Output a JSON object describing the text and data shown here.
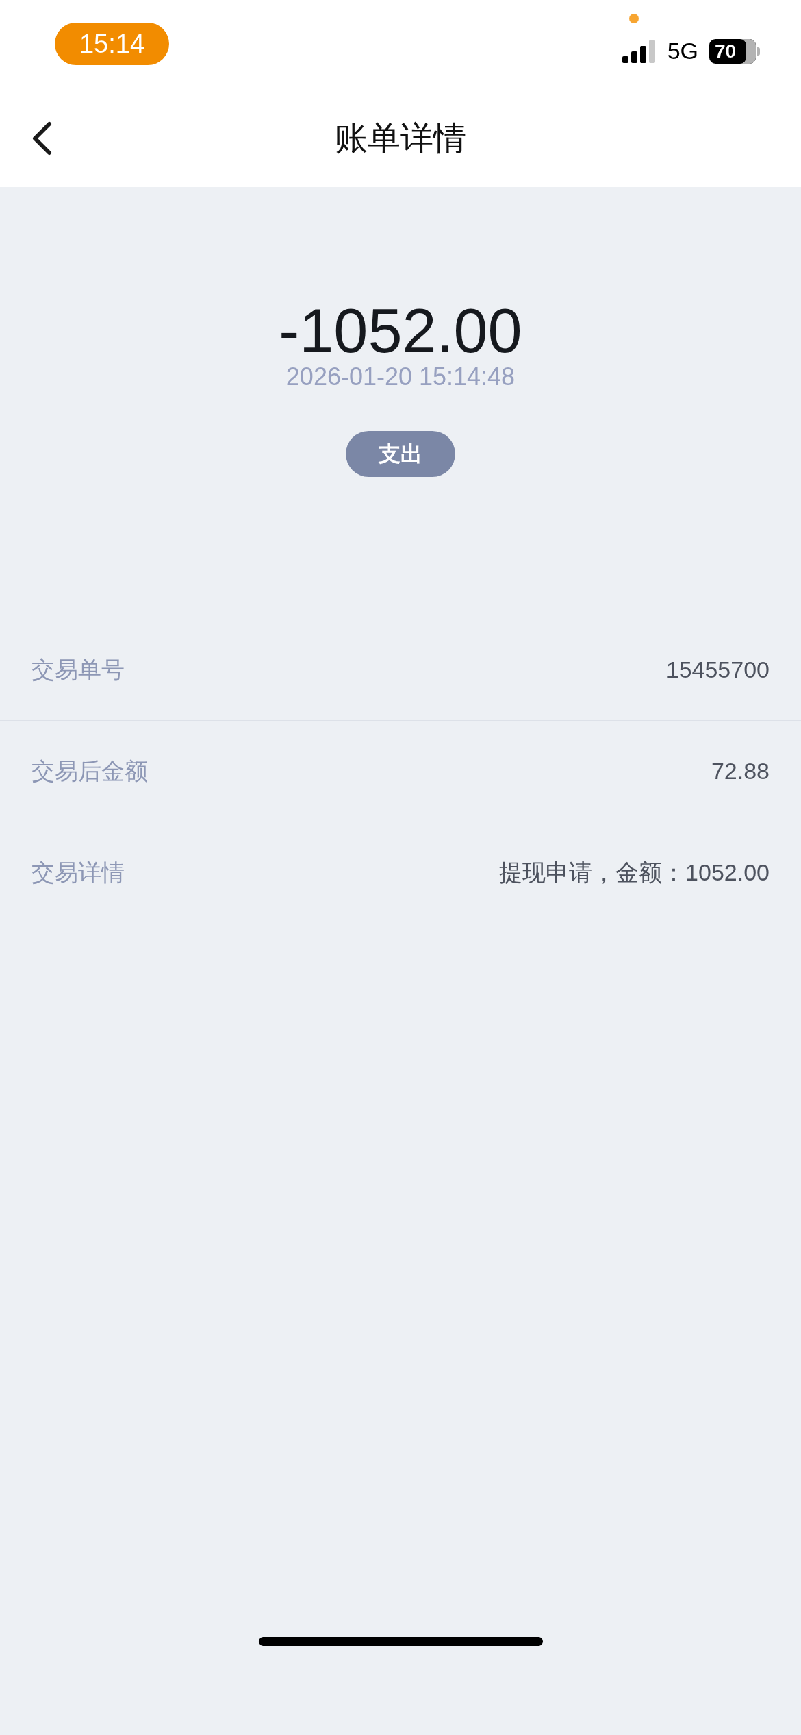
{
  "status_bar": {
    "time": "15:14",
    "network": "5G",
    "battery": "70"
  },
  "nav_bar": {
    "title": "账单详情"
  },
  "summary": {
    "amount": "-1052.00",
    "datetime": "2026-01-20 15:14:48",
    "tag": "支出"
  },
  "details": [
    {
      "label": "交易单号",
      "value": "15455700"
    },
    {
      "label": "交易后金额",
      "value": "72.88"
    },
    {
      "label": "交易详情",
      "value": "提现申请，金额：1052.00"
    }
  ]
}
